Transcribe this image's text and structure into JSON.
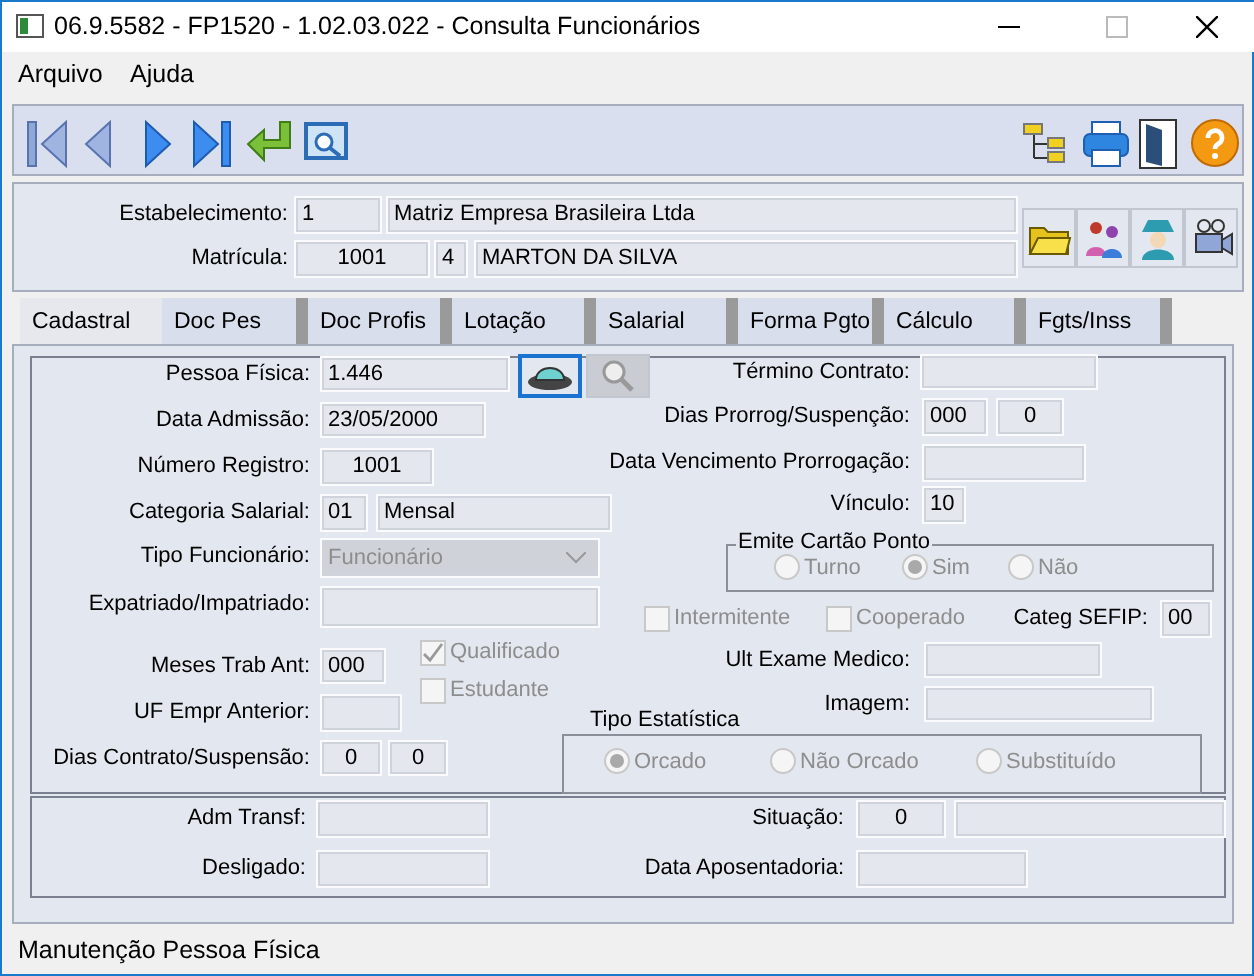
{
  "window": {
    "title": "06.9.5582 - FP1520 - 1.02.03.022 - Consulta Funcionários"
  },
  "menu": [
    {
      "label": "Arquivo"
    },
    {
      "label": "Ajuda"
    }
  ],
  "header": {
    "estabelecimento": {
      "label": "Estabelecimento:",
      "code": "1",
      "name": "Matriz Empresa Brasileira Ltda"
    },
    "matricula": {
      "label": "Matrícula:",
      "number": "1001",
      "digit": "4",
      "name": "MARTON DA SILVA"
    }
  },
  "tabs": [
    {
      "label": "Cadastral",
      "selected": true
    },
    {
      "label": "Doc Pes",
      "selected": false
    },
    {
      "label": "Doc Profis",
      "selected": false
    },
    {
      "label": "Lotação",
      "selected": false
    },
    {
      "label": "Salarial",
      "selected": false
    },
    {
      "label": "Forma Pgto",
      "selected": false
    },
    {
      "label": "Cálculo",
      "selected": false
    },
    {
      "label": "Fgts/Inss",
      "selected": false
    }
  ],
  "form": [
    {
      "kind": "field",
      "label": "Pessoa Física:",
      "values": [
        "1.446"
      ]
    },
    {
      "kind": "field",
      "label": "Término Contrato:"
    },
    {
      "kind": "field",
      "label": "Data Admissão:",
      "values": [
        "23/05/2000"
      ]
    },
    {
      "kind": "field",
      "label": "Dias Prorrog/Suspenção:",
      "values": [
        "000",
        "0"
      ]
    },
    {
      "kind": "field",
      "label": "Número Registro:",
      "values": [
        "1001"
      ]
    },
    {
      "kind": "field",
      "label": "Data Vencimento Prorrogação:"
    },
    {
      "kind": "field",
      "label": "Categoria Salarial:",
      "values": [
        "01",
        "Mensal"
      ]
    },
    {
      "kind": "field",
      "label": "Vínculo:",
      "values": [
        "10"
      ]
    },
    {
      "kind": "combo",
      "label": "Tipo Funcionário:",
      "value": "Funcionário",
      "disabled": true
    },
    {
      "kind": "radio_group",
      "title": "Emite Cartão Ponto",
      "disabled": true,
      "options": [
        {
          "label": "Turno",
          "selected": false
        },
        {
          "label": "Sim",
          "selected": true
        },
        {
          "label": "Não",
          "selected": false
        }
      ]
    },
    {
      "kind": "field",
      "label": "Expatriado/Impatriado:"
    },
    {
      "kind": "checkbox",
      "label": "Intermitente",
      "checked": false,
      "disabled": true
    },
    {
      "kind": "checkbox",
      "label": "Cooperado",
      "checked": false,
      "disabled": true
    },
    {
      "kind": "field",
      "label": "Categ SEFIP:",
      "values": [
        "00"
      ]
    },
    {
      "kind": "field",
      "label": "Meses Trab Ant:",
      "values": [
        "000"
      ]
    },
    {
      "kind": "checkbox",
      "label": "Qualificado",
      "checked": true,
      "disabled": true
    },
    {
      "kind": "field",
      "label": "Ult Exame Medico:"
    },
    {
      "kind": "checkbox",
      "label": "Estudante",
      "checked": false,
      "disabled": true
    },
    {
      "kind": "field",
      "label": "Imagem:"
    },
    {
      "kind": "field",
      "label": "UF Empr Anterior:"
    },
    {
      "kind": "field",
      "label": "Dias Contrato/Suspensão:",
      "values": [
        "0",
        "0"
      ]
    },
    {
      "kind": "radio_group",
      "title": "Tipo Estatística",
      "disabled": true,
      "options": [
        {
          "label": "Orcado",
          "selected": true
        },
        {
          "label": "Não Orcado",
          "selected": false
        },
        {
          "label": "Substituído",
          "selected": false
        }
      ]
    },
    {
      "kind": "field",
      "label": "Adm Transf:"
    },
    {
      "kind": "field",
      "label": "Situação:",
      "values": [
        "0"
      ]
    },
    {
      "kind": "field",
      "label": "Desligado:"
    },
    {
      "kind": "field",
      "label": "Data Aposentadoria:"
    }
  ],
  "status_bar": {
    "text": "Manutenção Pessoa Física"
  }
}
